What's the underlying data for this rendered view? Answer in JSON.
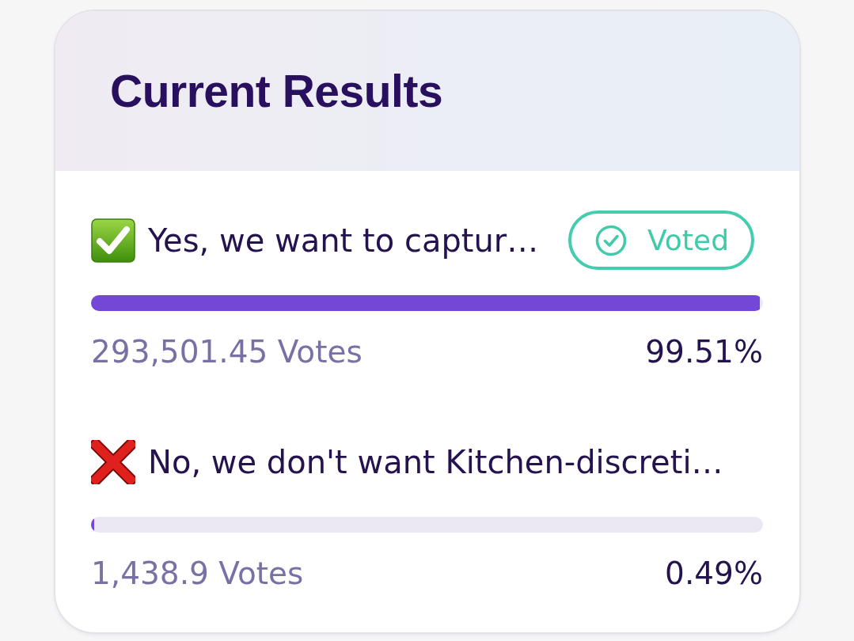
{
  "title": "Current Results",
  "options": [
    {
      "kind": "yes",
      "label": "Yes, we want to captur…",
      "badge": "Voted",
      "level": 0.9951,
      "votes": "293,501.45 Votes",
      "percent": "99.51%"
    },
    {
      "kind": "no",
      "label": "No, we don't want Kitchen-discreti…",
      "level": 0.0049,
      "votes": "1,438.9 Votes",
      "percent": "0.49%"
    }
  ]
}
